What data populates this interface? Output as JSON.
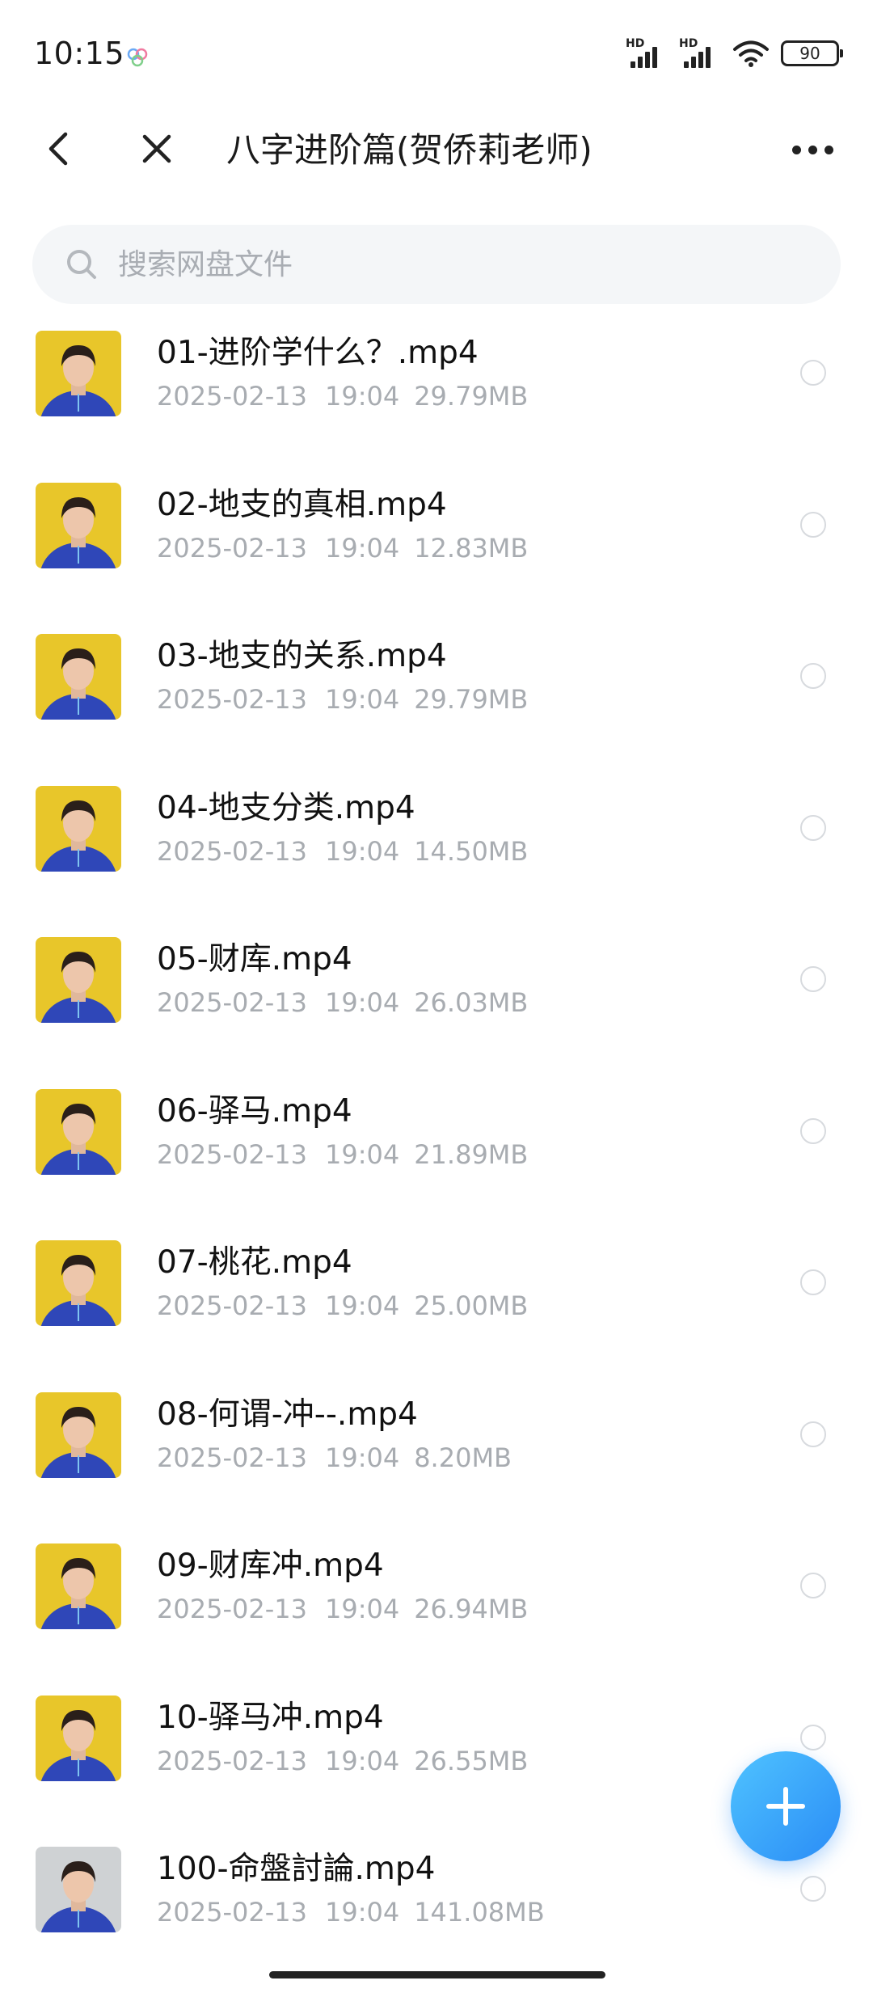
{
  "status_bar": {
    "time": "10:15",
    "signal_label": "HD",
    "battery": "90"
  },
  "nav": {
    "title": "八字进阶篇(贺侨莉老师)"
  },
  "search": {
    "placeholder": "搜索网盘文件"
  },
  "files": [
    {
      "name": "01-进阶学什么？.mp4",
      "date": "2025-02-13",
      "time": "19:04",
      "size": "29.79MB"
    },
    {
      "name": "02-地支的真相.mp4",
      "date": "2025-02-13",
      "time": "19:04",
      "size": "12.83MB"
    },
    {
      "name": "03-地支的关系.mp4",
      "date": "2025-02-13",
      "time": "19:04",
      "size": "29.79MB"
    },
    {
      "name": "04-地支分类.mp4",
      "date": "2025-02-13",
      "time": "19:04",
      "size": "14.50MB"
    },
    {
      "name": "05-财库.mp4",
      "date": "2025-02-13",
      "time": "19:04",
      "size": "26.03MB"
    },
    {
      "name": "06-驿马.mp4",
      "date": "2025-02-13",
      "time": "19:04",
      "size": "21.89MB"
    },
    {
      "name": "07-桃花.mp4",
      "date": "2025-02-13",
      "time": "19:04",
      "size": "25.00MB"
    },
    {
      "name": "08-何谓-冲--.mp4",
      "date": "2025-02-13",
      "time": "19:04",
      "size": "8.20MB"
    },
    {
      "name": "09-财库冲.mp4",
      "date": "2025-02-13",
      "time": "19:04",
      "size": "26.94MB"
    },
    {
      "name": "10-驿马冲.mp4",
      "date": "2025-02-13",
      "time": "19:04",
      "size": "26.55MB"
    },
    {
      "name": "100-命盤討論.mp4",
      "date": "2025-02-13",
      "time": "19:04",
      "size": "141.08MB"
    }
  ],
  "colors": {
    "accent": "#2a8cf6",
    "meta_text": "#a8acb1",
    "search_bg": "#f4f6f8"
  },
  "icons": {
    "back": "chevron-left-icon",
    "close": "close-icon",
    "more": "more-icon",
    "search": "search-icon",
    "add": "plus-icon"
  }
}
